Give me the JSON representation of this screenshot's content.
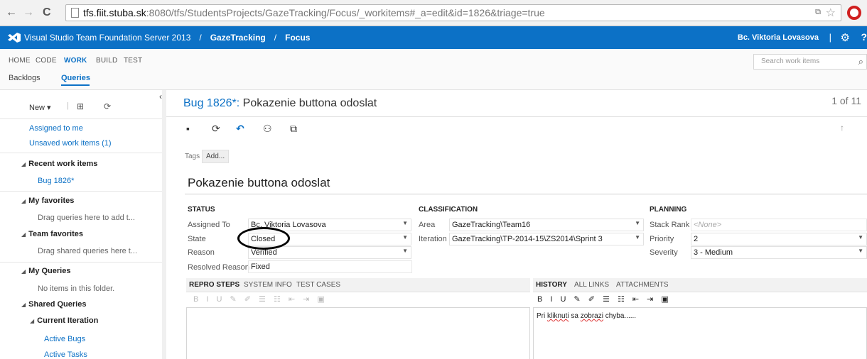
{
  "browser": {
    "back": "←",
    "forward": "→",
    "reload": "C",
    "url_host": "tfs.fiit.stuba.sk",
    "url_rest": ":8080/tfs/StudentsProjects/GazeTracking/Focus/_workitems#_a=edit&id=1826&triage=true"
  },
  "header": {
    "product": "Visual Studio Team Foundation Server 2013",
    "separator": "/",
    "project": "GazeTracking",
    "team": "Focus",
    "user": "Bc. Viktoria Lovasova",
    "pipe": "|",
    "help": "?"
  },
  "topnav": {
    "items": [
      "HOME",
      "CODE",
      "WORK",
      "BUILD",
      "TEST"
    ],
    "sub": [
      "Backlogs",
      "Queries"
    ],
    "search_placeholder": "Search work items"
  },
  "left": {
    "new_label": "New ▾",
    "assigned_to_me": "Assigned to me",
    "unsaved": "Unsaved work items (1)",
    "recent_header": "Recent work items",
    "recent_item": "Bug 1826*",
    "favorites_header": "My favorites",
    "favorites_hint": "Drag queries here to add t...",
    "team_fav_header": "Team favorites",
    "team_fav_hint": "Drag shared queries here t...",
    "my_queries_header": "My Queries",
    "my_queries_empty": "No items in this folder.",
    "shared_header": "Shared Queries",
    "current_iter_header": "Current Iteration",
    "active_bugs": "Active Bugs",
    "active_tasks": "Active Tasks"
  },
  "workitem": {
    "id_label": "Bug 1826*:",
    "title": "Pokazenie buttona odoslat",
    "page_count": "1 of 11",
    "tags_label": "Tags",
    "add_tag": "Add...",
    "summary": "Pokazenie buttona odoslat"
  },
  "status": {
    "header": "STATUS",
    "assigned_label": "Assigned To",
    "assigned_value": "Bc. Viktoria Lovasova",
    "state_label": "State",
    "state_value": "Closed",
    "reason_label": "Reason",
    "reason_value": "Verified",
    "resolved_label": "Resolved Reason",
    "resolved_value": "Fixed"
  },
  "classification": {
    "header": "CLASSIFICATION",
    "area_label": "Area",
    "area_value": "GazeTracking\\Team16",
    "iteration_label": "Iteration",
    "iteration_value": "GazeTracking\\TP-2014-15\\ZS2014\\Sprint 3"
  },
  "planning": {
    "header": "PLANNING",
    "stack_label": "Stack Rank",
    "stack_value": "<None>",
    "priority_label": "Priority",
    "priority_value": "2",
    "severity_label": "Severity",
    "severity_value": "3 - Medium"
  },
  "tabs_left": [
    "REPRO STEPS",
    "SYSTEM INFO",
    "TEST CASES"
  ],
  "tabs_right": [
    "HISTORY",
    "ALL LINKS",
    "ATTACHMENTS"
  ],
  "rte_toolbar": "B I U ✎ ✐ ☰ ☷ ⇤ ⇥ ▣",
  "history": {
    "before": "Pri ",
    "w1": "kliknuti",
    "mid": " sa ",
    "w2": "zobrazi",
    "after": " chyba......"
  },
  "colors": {
    "accent": "#0c71c6",
    "header_bg": "#0c71c6"
  }
}
